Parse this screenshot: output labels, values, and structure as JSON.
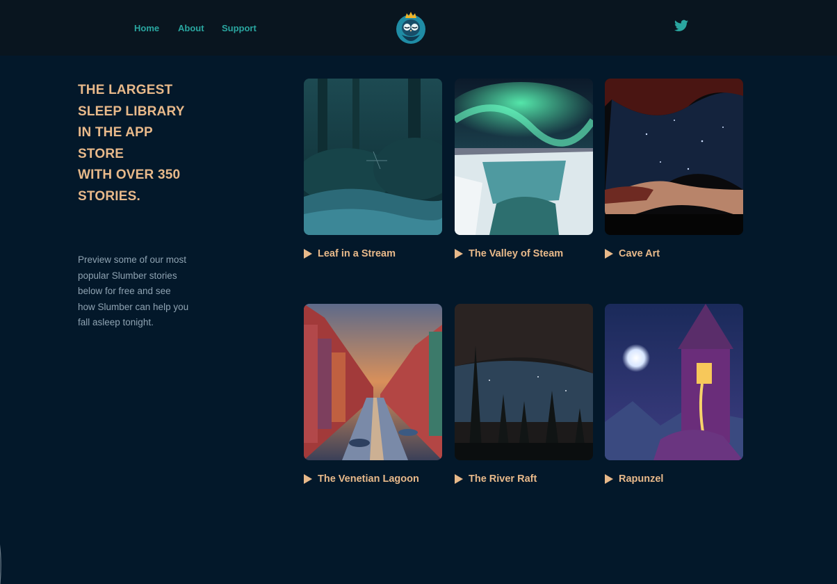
{
  "nav": {
    "links": [
      "Home",
      "About",
      "Support"
    ],
    "logo": "slumber-owl-logo",
    "social": "twitter-icon",
    "link_color": "#2aa6a0"
  },
  "hero": {
    "headline": "THE LARGEST\nSLEEP LIBRARY\nIN THE APP\nSTORE\nWITH OVER 350\nSTORIES.",
    "blurb": "Preview some of our most popular Slumber stories below for free and see how Slumber can help you fall asleep tonight."
  },
  "stories": [
    {
      "title": "Leaf in a Stream"
    },
    {
      "title": "The Valley of Steam"
    },
    {
      "title": "Cave Art"
    },
    {
      "title": "The Venetian Lagoon"
    },
    {
      "title": "The River Raft"
    },
    {
      "title": "Rapunzel"
    }
  ],
  "colors": {
    "background": "#03182a",
    "nav_background": "#09151f",
    "accent": "#e8b98a",
    "body_text": "#8fa3b2"
  }
}
